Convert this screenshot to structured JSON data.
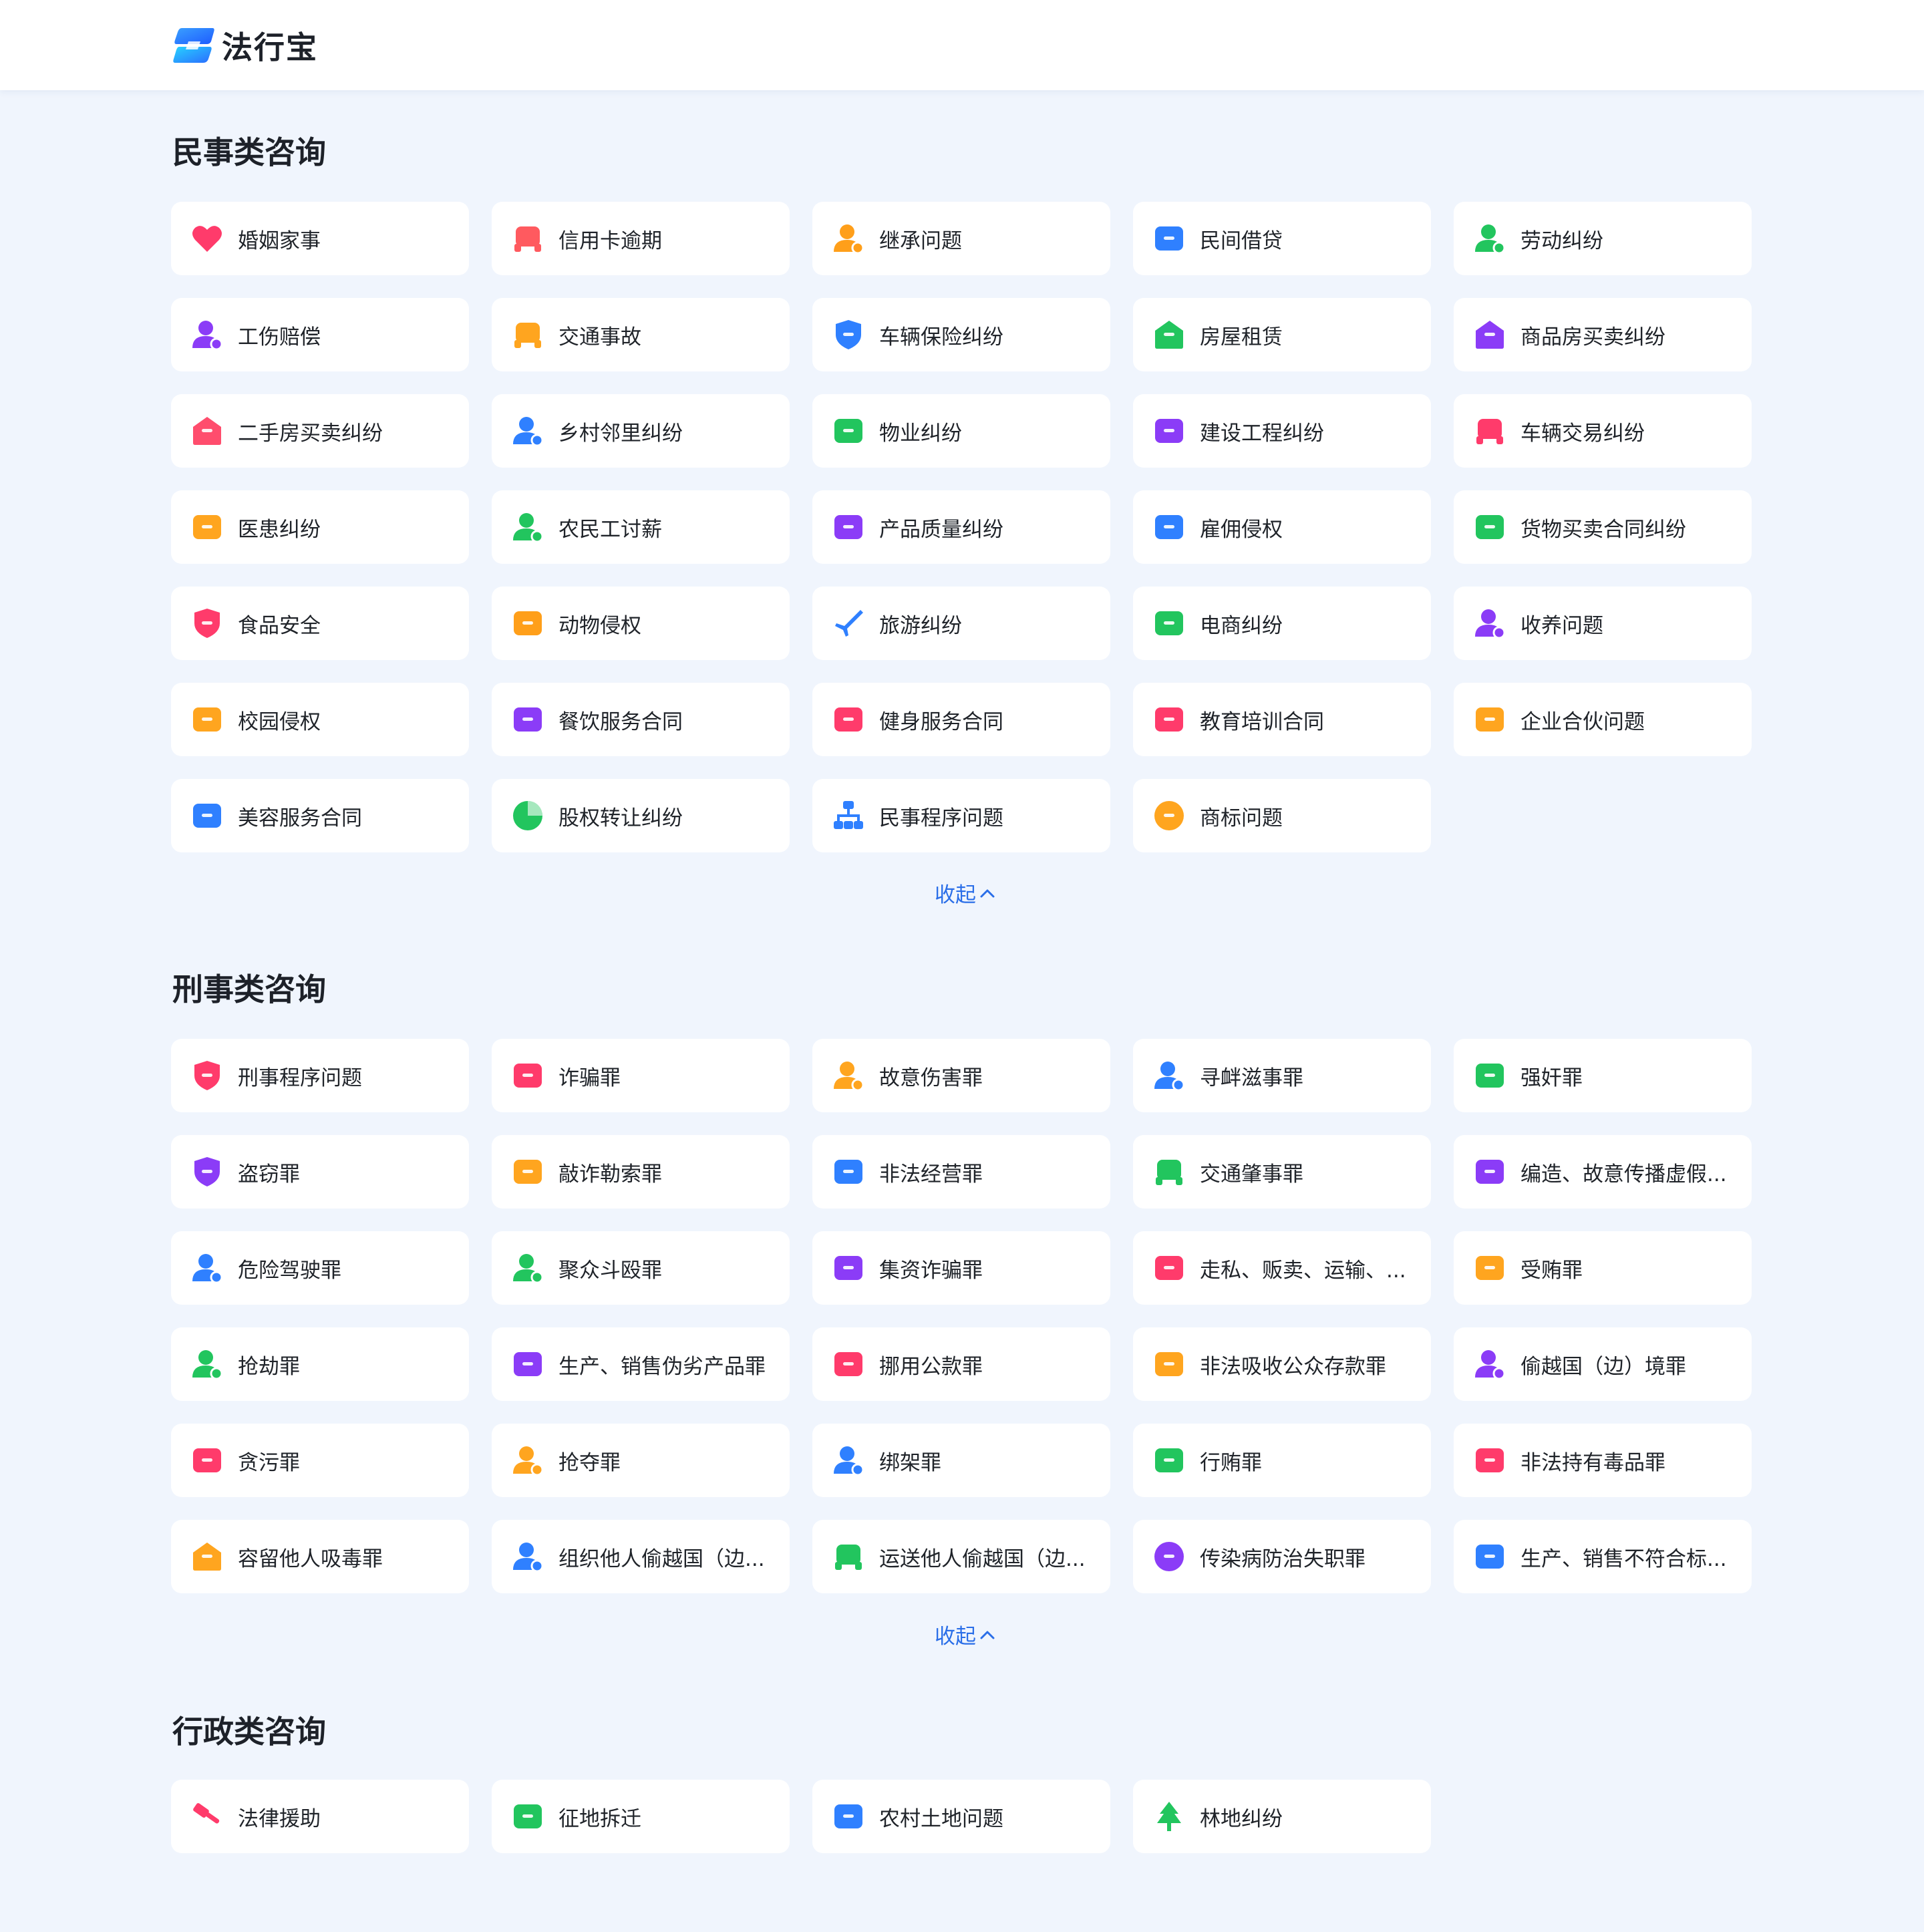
{
  "header": {
    "logo_text": "法行宝"
  },
  "sections": [
    {
      "title": "民事类咨询",
      "collapse_label": "收起",
      "items": [
        {
          "label": "婚姻家事",
          "icon": "heart-icon",
          "color": "#ff3b6b"
        },
        {
          "label": "信用卡逾期",
          "icon": "credit-card-icon",
          "color": "#ff5a5f"
        },
        {
          "label": "继承问题",
          "icon": "user-inherit-icon",
          "color": "#ff9f1a"
        },
        {
          "label": "民间借贷",
          "icon": "loan-icon",
          "color": "#2f80ff"
        },
        {
          "label": "劳动纠纷",
          "icon": "worker-icon",
          "color": "#22c55e"
        },
        {
          "label": "工伤赔偿",
          "icon": "user-injury-icon",
          "color": "#8b3cf7"
        },
        {
          "label": "交通事故",
          "icon": "car-front-icon",
          "color": "#ffa51f"
        },
        {
          "label": "车辆保险纠纷",
          "icon": "car-shield-icon",
          "color": "#2f80ff"
        },
        {
          "label": "房屋租赁",
          "icon": "house-rent-icon",
          "color": "#22c55e"
        },
        {
          "label": "商品房买卖纠纷",
          "icon": "house-yuan-icon",
          "color": "#8b3cf7"
        },
        {
          "label": "二手房买卖纠纷",
          "icon": "house-exchange-icon",
          "color": "#ff4d6d"
        },
        {
          "label": "乡村邻里纠纷",
          "icon": "neighbor-icon",
          "color": "#2f80ff"
        },
        {
          "label": "物业纠纷",
          "icon": "property-key-icon",
          "color": "#22c55e"
        },
        {
          "label": "建设工程纠纷",
          "icon": "construction-icon",
          "color": "#8b3cf7"
        },
        {
          "label": "车辆交易纠纷",
          "icon": "car-trade-icon",
          "color": "#ff3b6b"
        },
        {
          "label": "医患纠纷",
          "icon": "medical-bag-icon",
          "color": "#ffa51f"
        },
        {
          "label": "农民工讨薪",
          "icon": "helmet-worker-icon",
          "color": "#22c55e"
        },
        {
          "label": "产品质量纠纷",
          "icon": "monitor-icon",
          "color": "#8b3cf7"
        },
        {
          "label": "雇佣侵权",
          "icon": "employ-doc-icon",
          "color": "#2f80ff"
        },
        {
          "label": "货物买卖合同纠纷",
          "icon": "wallet-icon",
          "color": "#22c55e"
        },
        {
          "label": "食品安全",
          "icon": "food-shield-icon",
          "color": "#ff3b6b"
        },
        {
          "label": "动物侵权",
          "icon": "animal-icon",
          "color": "#ff9f1a"
        },
        {
          "label": "旅游纠纷",
          "icon": "plane-icon",
          "color": "#2f80ff"
        },
        {
          "label": "电商纠纷",
          "icon": "shopping-bag-icon",
          "color": "#22c55e"
        },
        {
          "label": "收养问题",
          "icon": "adopt-heart-icon",
          "color": "#8b3cf7"
        },
        {
          "label": "校园侵权",
          "icon": "graduation-cap-icon",
          "color": "#ffa51f"
        },
        {
          "label": "餐饮服务合同",
          "icon": "fork-knife-icon",
          "color": "#8b3cf7"
        },
        {
          "label": "健身服务合同",
          "icon": "dumbbell-icon",
          "color": "#ff3b6b"
        },
        {
          "label": "教育培训合同",
          "icon": "book-icon",
          "color": "#ff3b6b"
        },
        {
          "label": "企业合伙问题",
          "icon": "briefcase-icon",
          "color": "#ffa51f"
        },
        {
          "label": "美容服务合同",
          "icon": "beauty-icon",
          "color": "#2f80ff"
        },
        {
          "label": "股权转让纠纷",
          "icon": "pie-chart-icon",
          "color": "#22c55e"
        },
        {
          "label": "民事程序问题",
          "icon": "hierarchy-icon",
          "color": "#2f80ff"
        },
        {
          "label": "商标问题",
          "icon": "trademark-icon",
          "color": "#ffa51f"
        }
      ]
    },
    {
      "title": "刑事类咨询",
      "collapse_label": "收起",
      "items": [
        {
          "label": "刑事程序问题",
          "icon": "police-shield-icon",
          "color": "#ff3b6b"
        },
        {
          "label": "诈骗罪",
          "icon": "phone-warning-icon",
          "color": "#ff3b6b"
        },
        {
          "label": "故意伤害罪",
          "icon": "user-warning-icon",
          "color": "#ffa51f"
        },
        {
          "label": "寻衅滋事罪",
          "icon": "user-provoke-icon",
          "color": "#2f80ff"
        },
        {
          "label": "强奸罪",
          "icon": "bed-icon",
          "color": "#22c55e"
        },
        {
          "label": "盗窃罪",
          "icon": "hexagon-alert-icon",
          "color": "#8b3cf7"
        },
        {
          "label": "敲诈勒索罪",
          "icon": "wallet-extort-icon",
          "color": "#ffa51f"
        },
        {
          "label": "非法经营罪",
          "icon": "shop-yuan-icon",
          "color": "#2f80ff"
        },
        {
          "label": "交通肇事罪",
          "icon": "car-accident-icon",
          "color": "#22c55e"
        },
        {
          "label": "编造、故意传播虚假...",
          "icon": "radio-icon",
          "color": "#8b3cf7"
        },
        {
          "label": "危险驾驶罪",
          "icon": "user-driving-icon",
          "color": "#2f80ff"
        },
        {
          "label": "聚众斗殴罪",
          "icon": "user-fight-icon",
          "color": "#22c55e"
        },
        {
          "label": "集资诈骗罪",
          "icon": "money-bag-icon",
          "color": "#8b3cf7"
        },
        {
          "label": "走私、贩卖、运输、...",
          "icon": "bag-alert-icon",
          "color": "#ff3b6b"
        },
        {
          "label": "受贿罪",
          "icon": "bribe-arrow-icon",
          "color": "#ffa51f"
        },
        {
          "label": "抢劫罪",
          "icon": "robber-icon",
          "color": "#22c55e"
        },
        {
          "label": "生产、销售伪劣产品罪",
          "icon": "fake-product-icon",
          "color": "#8b3cf7"
        },
        {
          "label": "挪用公款罪",
          "icon": "misappropriate-icon",
          "color": "#ff3b6b"
        },
        {
          "label": "非法吸收公众存款罪",
          "icon": "deposit-icon",
          "color": "#ffa51f"
        },
        {
          "label": "偷越国（边）境罪",
          "icon": "user-border-icon",
          "color": "#8b3cf7"
        },
        {
          "label": "贪污罪",
          "icon": "embezzle-icon",
          "color": "#ff3b6b"
        },
        {
          "label": "抢夺罪",
          "icon": "snatch-icon",
          "color": "#ffa51f"
        },
        {
          "label": "绑架罪",
          "icon": "kidnap-icon",
          "color": "#2f80ff"
        },
        {
          "label": "行贿罪",
          "icon": "bribe-give-icon",
          "color": "#22c55e"
        },
        {
          "label": "非法持有毒品罪",
          "icon": "poison-jar-icon",
          "color": "#ff3b6b"
        },
        {
          "label": "容留他人吸毒罪",
          "icon": "house-skull-icon",
          "color": "#ffa51f"
        },
        {
          "label": "组织他人偷越国（边...",
          "icon": "user-organize-icon",
          "color": "#2f80ff"
        },
        {
          "label": "运送他人偷越国（边...",
          "icon": "truck-icon",
          "color": "#22c55e"
        },
        {
          "label": "传染病防治失职罪",
          "icon": "pill-icon",
          "color": "#8b3cf7"
        },
        {
          "label": "生产、销售不符合标...",
          "icon": "doc-icon",
          "color": "#2f80ff"
        }
      ]
    },
    {
      "title": "行政类咨询",
      "items": [
        {
          "label": "法律援助",
          "icon": "gavel-icon",
          "color": "#ff3b6b"
        },
        {
          "label": "征地拆迁",
          "icon": "demolish-icon",
          "color": "#22c55e"
        },
        {
          "label": "农村土地问题",
          "icon": "land-map-icon",
          "color": "#2f80ff"
        },
        {
          "label": "林地纠纷",
          "icon": "tree-icon",
          "color": "#22c55e"
        }
      ]
    }
  ]
}
